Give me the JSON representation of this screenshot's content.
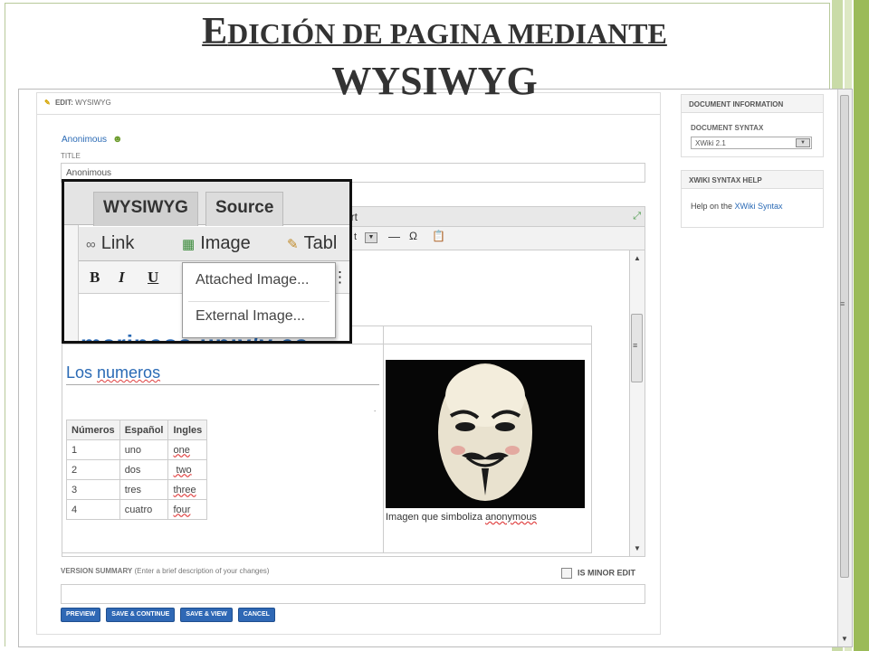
{
  "slide": {
    "title_line1_cap": "E",
    "title_line1_rest": "dición de pagina mediante",
    "title_line2": "WYSIWYG"
  },
  "colors": {
    "accent": "#2f68b5",
    "slide_stripe": "#9bbb59",
    "link": "#2a6ab5"
  },
  "edit_header": {
    "label": "EDIT:",
    "mode": "WYSIWYG",
    "icon": "pencil-icon"
  },
  "author": {
    "name": "Anonimous",
    "icon": "people-icon"
  },
  "title_field": {
    "label": "TITLE",
    "value": "Anonimous"
  },
  "editor": {
    "tab_fragment": "ort",
    "toolbar_fragment": "t",
    "toolbar_icons": [
      "horizontal-rule-icon",
      "omega-icon",
      "paste-icon"
    ]
  },
  "inset": {
    "tabs": [
      "WYSIWYG",
      "Source"
    ],
    "menus": [
      {
        "label": "Link",
        "icon": "link-icon"
      },
      {
        "label": "Image",
        "icon": "image-icon"
      },
      {
        "label": "Tabl",
        "icon": "table-icon"
      }
    ],
    "format_buttons": [
      "B",
      "I",
      "U"
    ],
    "dropdown": [
      "Attached Image...",
      "External Image..."
    ],
    "background_text": "marineos univ/v es"
  },
  "content": {
    "heading_a": "Los ",
    "heading_b": "numeros",
    "table": {
      "headers": [
        "Números",
        "Español",
        "Ingles"
      ],
      "rows": [
        [
          "1",
          "uno",
          "one"
        ],
        [
          "2",
          "dos",
          " two"
        ],
        [
          "3",
          "tres",
          "three"
        ],
        [
          "4",
          "cuatro",
          "four"
        ]
      ]
    },
    "image_caption_a": "Imagen que simboliza ",
    "image_caption_b": "anonymous"
  },
  "sidebar": {
    "doc_info": {
      "title": "DOCUMENT INFORMATION",
      "syntax_label": "DOCUMENT SYNTAX",
      "syntax_value": "XWiki 2.1"
    },
    "syntax_help": {
      "title": "XWIKI SYNTAX HELP",
      "text": "Help on the ",
      "link": "XWiki Syntax"
    }
  },
  "version_summary": {
    "label": "VERSION SUMMARY",
    "hint": " (Enter a brief description of your changes)",
    "value": ""
  },
  "minor_edit": {
    "label": "IS MINOR EDIT",
    "checked": false
  },
  "buttons": {
    "preview": "PREVIEW",
    "save_continue": "SAVE & CONTINUE",
    "save_view": "SAVE & VIEW",
    "cancel": "CANCEL"
  }
}
